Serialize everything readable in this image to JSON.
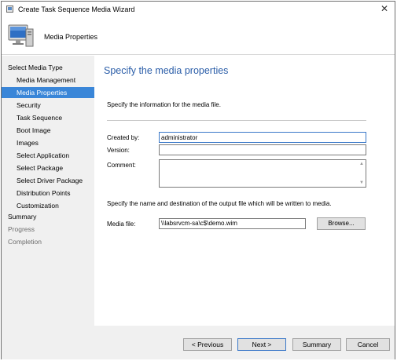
{
  "window": {
    "title": "Create Task Sequence Media Wizard",
    "close_glyph": "✕"
  },
  "header": {
    "title": "Media Properties",
    "icon": "computer-icon"
  },
  "nav": {
    "items": [
      {
        "label": "Select Media Type",
        "level": "top",
        "state": "normal"
      },
      {
        "label": "Media Management",
        "level": "sub",
        "state": "normal"
      },
      {
        "label": "Media Properties",
        "level": "sub",
        "state": "active"
      },
      {
        "label": "Security",
        "level": "sub",
        "state": "normal"
      },
      {
        "label": "Task Sequence",
        "level": "sub",
        "state": "normal"
      },
      {
        "label": "Boot Image",
        "level": "sub",
        "state": "normal"
      },
      {
        "label": "Images",
        "level": "sub",
        "state": "normal"
      },
      {
        "label": "Select Application",
        "level": "sub",
        "state": "normal"
      },
      {
        "label": "Select Package",
        "level": "sub",
        "state": "normal"
      },
      {
        "label": "Select Driver Package",
        "level": "sub",
        "state": "normal"
      },
      {
        "label": "Distribution Points",
        "level": "sub",
        "state": "normal"
      },
      {
        "label": "Customization",
        "level": "sub",
        "state": "normal"
      },
      {
        "label": "Summary",
        "level": "top",
        "state": "normal"
      },
      {
        "label": "Progress",
        "level": "top",
        "state": "disabled"
      },
      {
        "label": "Completion",
        "level": "top",
        "state": "disabled"
      }
    ]
  },
  "content": {
    "page_title": "Specify the media properties",
    "instruction": "Specify the information for the media file.",
    "created_by": {
      "label": "Created by:",
      "value": "administrator"
    },
    "version": {
      "label": "Version:",
      "value": ""
    },
    "comment": {
      "label": "Comment:",
      "value": ""
    },
    "output_instruction": "Specify the name and destination of the output file which will be written to media.",
    "media_file": {
      "label": "Media file:",
      "value": "\\\\labsrvcm-sa\\c$\\demo.wim"
    },
    "browse_label": "Browse..."
  },
  "footer": {
    "previous_label": "< Previous",
    "next_label": "Next >",
    "summary_label": "Summary",
    "cancel_label": "Cancel"
  },
  "colors": {
    "accent": "#3a86d8",
    "title_blue": "#2a5da8",
    "nav_bg": "#f0f0f0"
  }
}
